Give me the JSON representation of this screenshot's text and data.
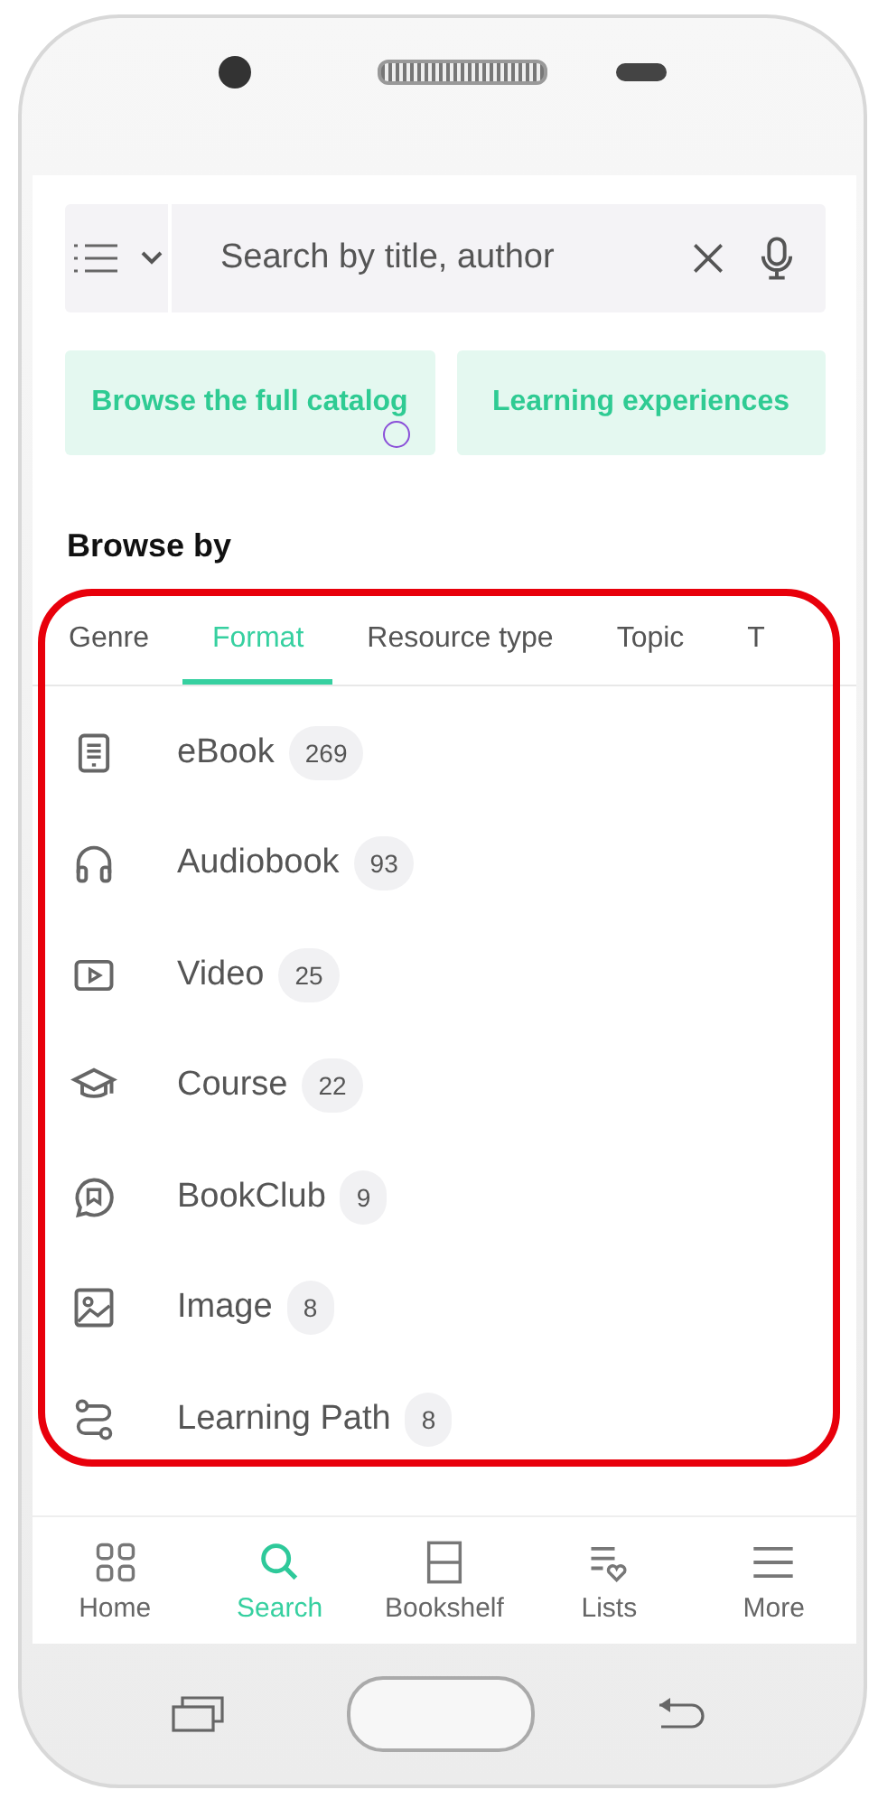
{
  "search": {
    "placeholder": "Search by title, author"
  },
  "promos": [
    "Browse the full catalog",
    "Learning experiences"
  ],
  "touch_indicator": true,
  "section_title": "Browse by",
  "tabs": [
    {
      "label": "Genre",
      "selected": false
    },
    {
      "label": "Format",
      "selected": true
    },
    {
      "label": "Resource type",
      "selected": false
    },
    {
      "label": "Topic",
      "selected": false
    },
    {
      "label": "T",
      "selected": false
    }
  ],
  "formats": [
    {
      "kind": "ebook",
      "label": "eBook",
      "count": "269"
    },
    {
      "kind": "audiobook",
      "label": "Audiobook",
      "count": "93"
    },
    {
      "kind": "video",
      "label": "Video",
      "count": "25"
    },
    {
      "kind": "course",
      "label": "Course",
      "count": "22"
    },
    {
      "kind": "bookclub",
      "label": "BookClub",
      "count": "9"
    },
    {
      "kind": "image",
      "label": "Image",
      "count": "8"
    },
    {
      "kind": "path",
      "label": "Learning Path",
      "count": "8"
    }
  ],
  "highlight": true,
  "nav": [
    {
      "kind": "home",
      "label": "Home",
      "selected": false
    },
    {
      "kind": "search",
      "label": "Search",
      "selected": true
    },
    {
      "kind": "bookshelf",
      "label": "Bookshelf",
      "selected": false
    },
    {
      "kind": "lists",
      "label": "Lists",
      "selected": false
    },
    {
      "kind": "more",
      "label": "More",
      "selected": false
    }
  ]
}
